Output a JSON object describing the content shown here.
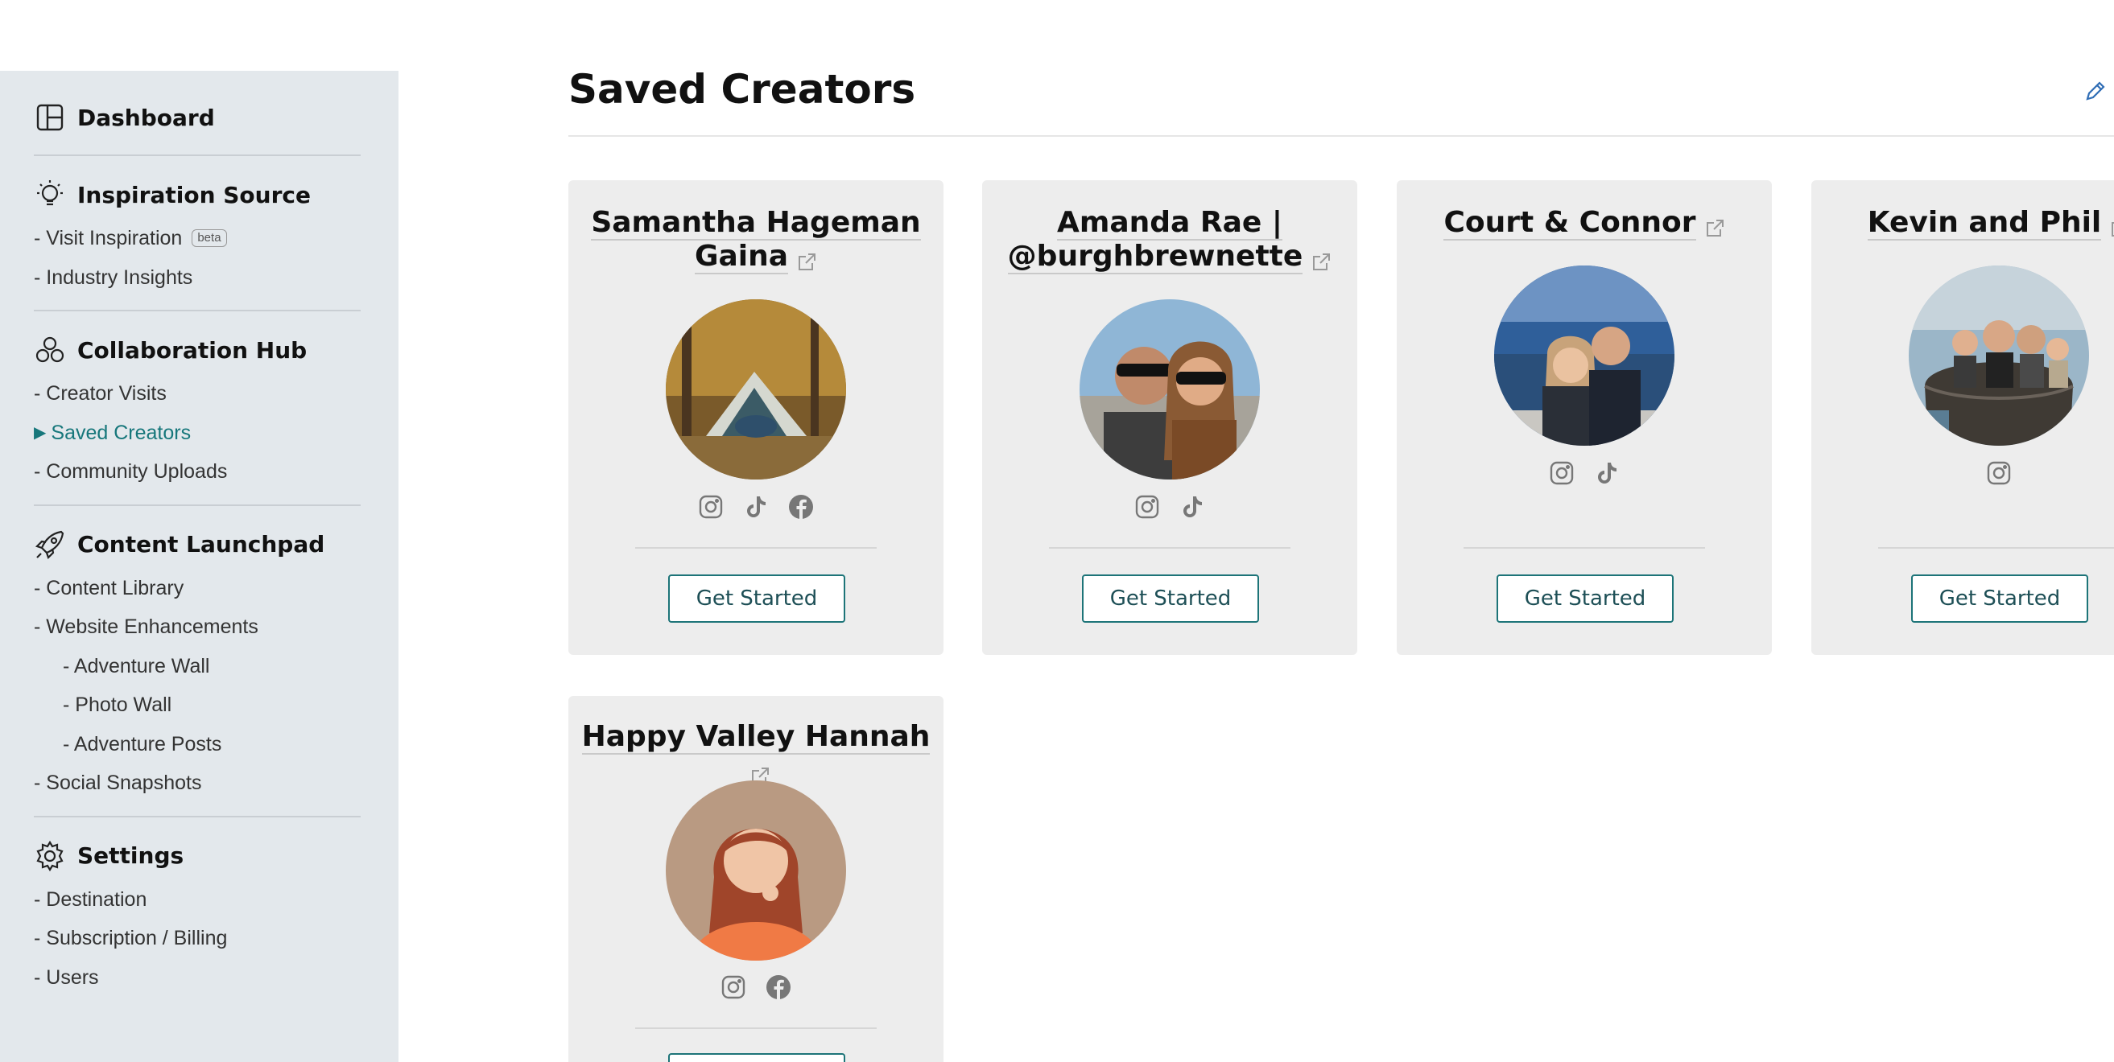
{
  "sidebar": {
    "dashboard": {
      "label": "Dashboard",
      "icon": "layout-icon"
    },
    "inspiration": {
      "label": "Inspiration Source",
      "icon": "lightbulb-icon",
      "items": [
        {
          "label": "- Visit Inspiration",
          "badge": "beta"
        },
        {
          "label": "- Industry Insights"
        }
      ]
    },
    "collaboration": {
      "label": "Collaboration Hub",
      "icon": "group-icon",
      "items": [
        {
          "label": "- Creator Visits"
        },
        {
          "label": "Saved Creators",
          "active": true
        },
        {
          "label": "- Community Uploads"
        }
      ]
    },
    "content": {
      "label": "Content Launchpad",
      "icon": "rocket-icon",
      "items": [
        {
          "label": "- Content Library"
        },
        {
          "label": "- Website Enhancements"
        },
        {
          "label": "- Adventure Wall",
          "sub": true
        },
        {
          "label": "- Photo Wall",
          "sub": true
        },
        {
          "label": "- Adventure Posts",
          "sub": true
        },
        {
          "label": "- Social Snapshots"
        }
      ]
    },
    "settings": {
      "label": "Settings",
      "icon": "gear-icon",
      "items": [
        {
          "label": "- Destination"
        },
        {
          "label": "- Subscription / Billing"
        },
        {
          "label": "- Users"
        }
      ]
    }
  },
  "main": {
    "title": "Saved Creators",
    "cta_label": "Get Started",
    "creators": [
      {
        "name_line1": "Samantha Hageman",
        "name_line2": "Gaina",
        "socials": [
          "instagram-icon",
          "tiktok-icon",
          "facebook-icon"
        ],
        "avatar": "photo-tent-couple"
      },
      {
        "name_line1": "Amanda Rae |",
        "name_line2": "@burghbrewnette",
        "socials": [
          "instagram-icon",
          "tiktok-icon"
        ],
        "avatar": "photo-couple-sunglasses"
      },
      {
        "name_line1": "Court & Connor",
        "name_line2": "",
        "socials": [
          "instagram-icon",
          "tiktok-icon"
        ],
        "avatar": "photo-couple-lake"
      },
      {
        "name_line1": "Kevin and Phil",
        "name_line2": "",
        "socials": [
          "instagram-icon"
        ],
        "avatar": "photo-family-barrel"
      },
      {
        "name_line1": "Happy Valley Hannah",
        "name_line2": "",
        "socials": [
          "instagram-icon",
          "facebook-icon"
        ],
        "avatar": "photo-woman-orange-sweater"
      }
    ]
  },
  "colors": {
    "sidebar_bg": "#e3e8ec",
    "accent": "#17777b",
    "card_bg": "#ededed"
  }
}
